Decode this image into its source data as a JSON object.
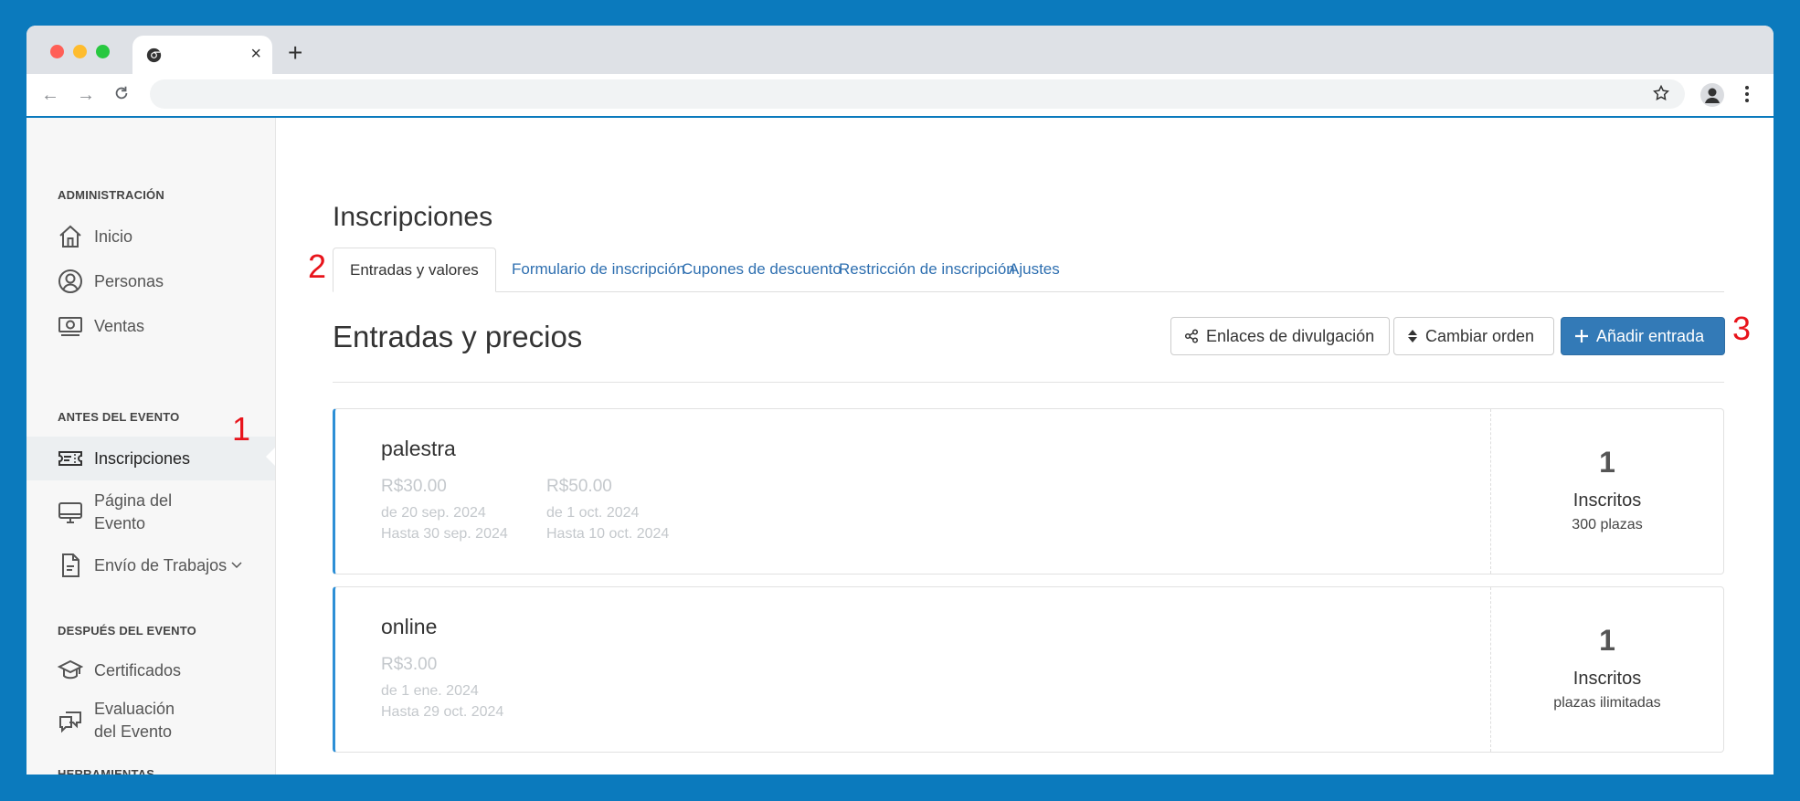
{
  "browser": {
    "tab_close": "×",
    "new_tab": "+"
  },
  "sidebar": {
    "sections": [
      {
        "label": "ADMINISTRACIÓN"
      },
      {
        "label": "ANTES DEL EVENTO"
      },
      {
        "label": "DESPUÉS DEL EVENTO"
      },
      {
        "label": "HERRAMIENTAS"
      }
    ],
    "items": [
      {
        "label": "Inicio",
        "icon": "home-icon"
      },
      {
        "label": "Personas",
        "icon": "user-circle-icon"
      },
      {
        "label": "Ventas",
        "icon": "money-icon"
      },
      {
        "label": "Inscripciones",
        "icon": "ticket-icon",
        "active": true
      },
      {
        "label_line1": "Página del",
        "label_line2": "Evento",
        "icon": "monitor-icon"
      },
      {
        "label": "Envío de Trabajos",
        "icon": "document-icon",
        "has_dropdown": true
      },
      {
        "label": "Certificados",
        "icon": "graduation-cap-icon"
      },
      {
        "label_line1": "Evaluación",
        "label_line2": "del Evento",
        "icon": "chat-bubbles-icon"
      }
    ]
  },
  "main": {
    "page_title": "Inscripciones",
    "tabs": [
      {
        "label": "Entradas y valores",
        "active": true
      },
      {
        "label": "Formulario de inscripción"
      },
      {
        "label": "Cupones de descuento"
      },
      {
        "label": "Restricción de inscripción"
      },
      {
        "label": "Ajustes"
      }
    ],
    "section_title": "Entradas y precios",
    "buttons": {
      "share_links": "Enlaces de divulgación",
      "change_order": "Cambiar orden",
      "add_ticket": "Añadir entrada"
    },
    "tickets": [
      {
        "name": "palestra",
        "prices": [
          {
            "amount": "R$30.00",
            "from": "de 20 sep. 2024",
            "until": "Hasta 30 sep. 2024"
          },
          {
            "amount": "R$50.00",
            "from": "de 1 oct. 2024",
            "until": "Hasta 10 oct. 2024"
          }
        ],
        "count": "1",
        "count_label": "Inscritos",
        "capacity": "300 plazas"
      },
      {
        "name": "online",
        "prices": [
          {
            "amount": "R$3.00",
            "from": "de 1 ene. 2024",
            "until": "Hasta 29 oct. 2024"
          }
        ],
        "count": "1",
        "count_label": "Inscritos",
        "capacity": "plazas ilimitadas"
      }
    ]
  },
  "callouts": {
    "one": "1",
    "two": "2",
    "three": "3"
  },
  "colors": {
    "background": "#0b7abd",
    "primary_button": "#337ab7",
    "link": "#2e6fb0",
    "ticket_accent": "#2d8fd6",
    "callout": "#e8141b"
  }
}
